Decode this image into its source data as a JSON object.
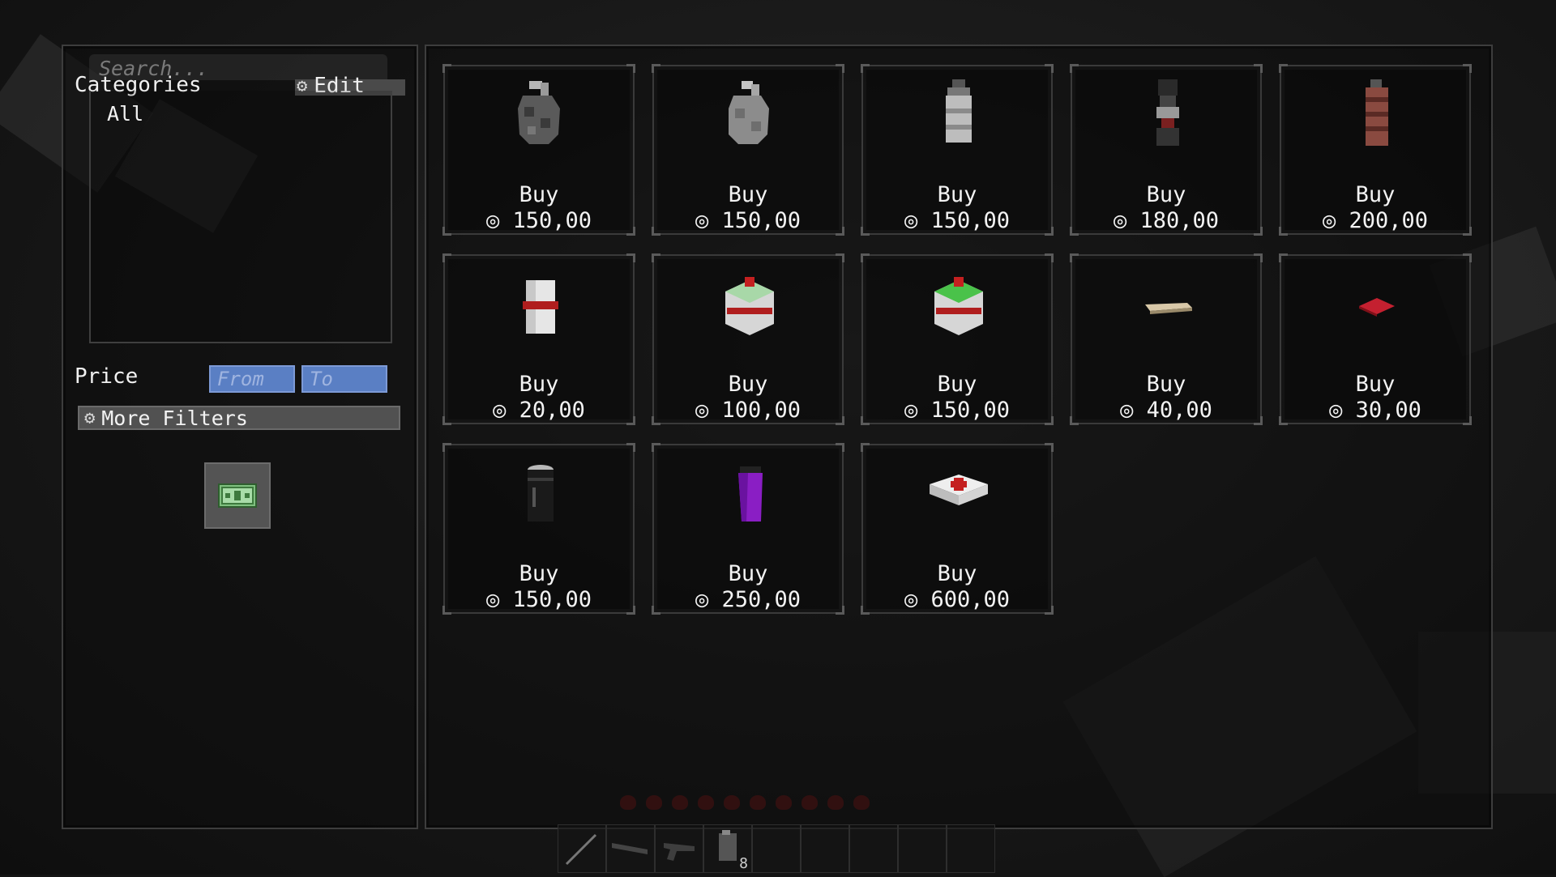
{
  "search": {
    "placeholder": "Search..."
  },
  "categories": {
    "title": "Categories",
    "edit_label": "Edit",
    "items": [
      "All"
    ]
  },
  "price": {
    "label": "Price",
    "from_placeholder": "From",
    "to_placeholder": "To"
  },
  "filters": {
    "more_label": "More Filters"
  },
  "wallet": {
    "icon": "money-bill-icon"
  },
  "products": [
    {
      "buy_label": "Buy",
      "price": "◎ 150,00",
      "icon": "grenade-dark-icon"
    },
    {
      "buy_label": "Buy",
      "price": "◎ 150,00",
      "icon": "grenade-gray-icon"
    },
    {
      "buy_label": "Buy",
      "price": "◎ 150,00",
      "icon": "smoke-grenade-icon"
    },
    {
      "buy_label": "Buy",
      "price": "◎ 180,00",
      "icon": "flashbang-icon"
    },
    {
      "buy_label": "Buy",
      "price": "◎ 200,00",
      "icon": "incendiary-grenade-icon"
    },
    {
      "buy_label": "Buy",
      "price": "◎ 20,00",
      "icon": "bandage-roll-icon"
    },
    {
      "buy_label": "Buy",
      "price": "◎ 100,00",
      "icon": "medkit-cube-icon"
    },
    {
      "buy_label": "Buy",
      "price": "◎ 150,00",
      "icon": "medkit-cube-green-icon"
    },
    {
      "buy_label": "Buy",
      "price": "◎ 40,00",
      "icon": "bandage-strip-icon"
    },
    {
      "buy_label": "Buy",
      "price": "◎ 30,00",
      "icon": "red-cloth-icon"
    },
    {
      "buy_label": "Buy",
      "price": "◎ 150,00",
      "icon": "energy-drink-black-icon"
    },
    {
      "buy_label": "Buy",
      "price": "◎ 250,00",
      "icon": "energy-drink-purple-icon"
    },
    {
      "buy_label": "Buy",
      "price": "◎ 600,00",
      "icon": "first-aid-kit-icon"
    }
  ],
  "hotbar": {
    "count_slot4": "8"
  },
  "colors": {
    "price_field": "#5a7fc4",
    "panel_border": "#3d3d3d",
    "text": "#f0f0f0"
  }
}
